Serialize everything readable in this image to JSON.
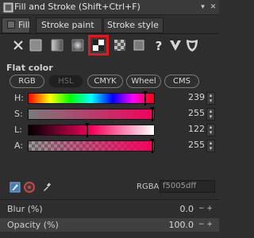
{
  "window": {
    "title": "Fill and Stroke (Shift+Ctrl+F)"
  },
  "tabs": [
    {
      "label": "Fill",
      "active": true
    },
    {
      "label": "Stroke paint",
      "active": false
    },
    {
      "label": "Stroke style",
      "active": false
    }
  ],
  "paint_types": [
    {
      "icon": "no-paint-icon"
    },
    {
      "icon": "flat-color-icon"
    },
    {
      "icon": "linear-gradient-icon"
    },
    {
      "icon": "radial-gradient-icon"
    },
    {
      "icon": "mesh-gradient-icon",
      "selected": true
    },
    {
      "icon": "pattern-icon"
    },
    {
      "icon": "swatch-icon"
    },
    {
      "icon": "unset-paint-icon"
    },
    {
      "icon": "evenodd-fill-rule-icon"
    },
    {
      "icon": "nonzero-fill-rule-icon"
    }
  ],
  "fill": {
    "heading": "Flat color",
    "color_models": [
      "RGB",
      "HSL",
      "CMYK",
      "Wheel",
      "CMS"
    ],
    "active_model": "HSL",
    "sliders": [
      {
        "label": "H:",
        "value": "239",
        "fraction": 0.94
      },
      {
        "label": "S:",
        "value": "255",
        "fraction": 1.0
      },
      {
        "label": "L:",
        "value": "122",
        "fraction": 0.48
      },
      {
        "label": "A:",
        "value": "255",
        "fraction": 1.0
      }
    ],
    "rgba_label": "RGBA:",
    "rgba_value": "f5005dff"
  },
  "properties": {
    "blur_label": "Blur (%)",
    "blur_value": "0.0",
    "opacity_label": "Opacity (%)",
    "opacity_value": "100.0"
  },
  "colors": {
    "selected_color": "#f5005d",
    "highlight_frame": "#e2161f"
  }
}
